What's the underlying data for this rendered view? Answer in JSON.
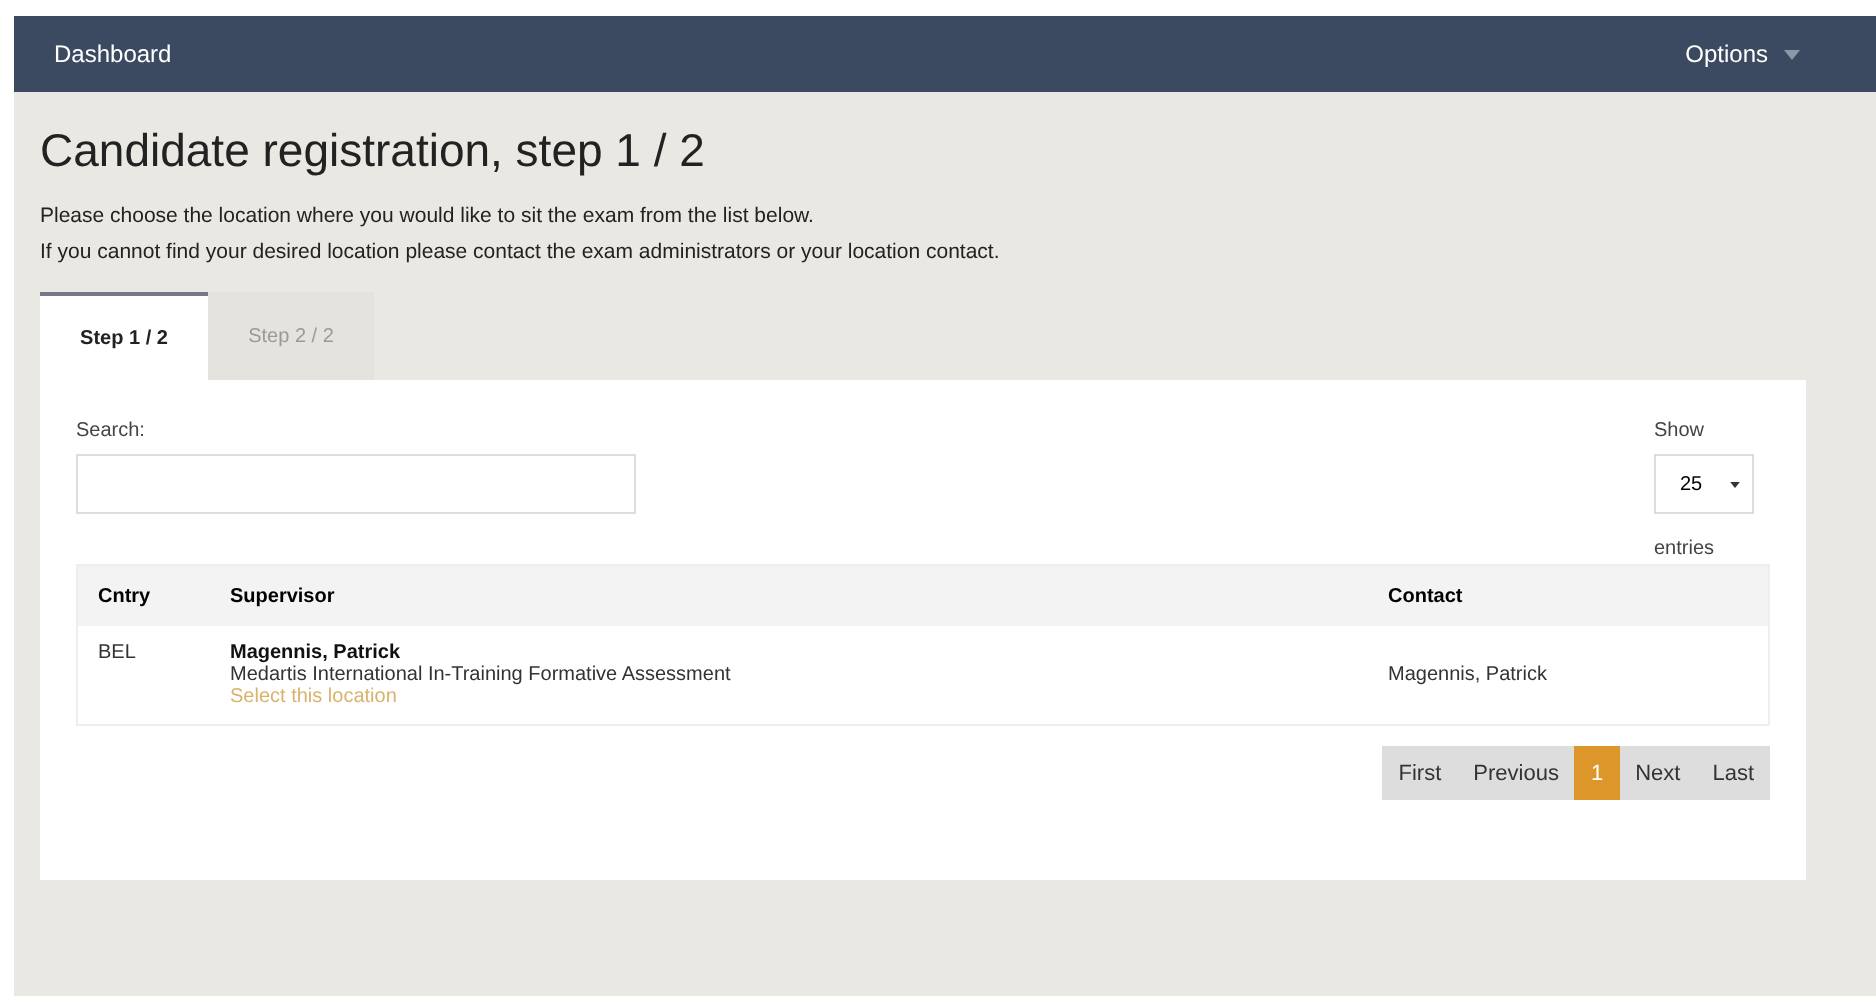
{
  "navbar": {
    "brand": "Dashboard",
    "menu": "Options"
  },
  "title": "Candidate registration, step 1 / 2",
  "intro": [
    "Please choose the location where you would like to sit the exam from the list below.",
    "If you cannot find your desired location please contact the exam administrators or your location contact."
  ],
  "tabs": [
    {
      "label": "Step 1 / 2",
      "selected": true
    },
    {
      "label": "Step 2 / 2",
      "selected": false
    }
  ],
  "search": {
    "label": "Search:"
  },
  "length": {
    "before": "Show",
    "value": "25",
    "after": "entries"
  },
  "table": {
    "columns": [
      "Cntry",
      "Supervisor",
      "Contact"
    ],
    "rows": [
      {
        "country": "BEL",
        "supervisor": "Magennis, Patrick",
        "description": "Medartis International In-Training Formative Assessment",
        "action": "Select this location",
        "contact": "Magennis, Patrick"
      }
    ]
  },
  "pagination": [
    {
      "label": "First",
      "selected": false
    },
    {
      "label": "Previous",
      "selected": false
    },
    {
      "label": "1",
      "selected": true
    },
    {
      "label": "Next",
      "selected": false
    },
    {
      "label": "Last",
      "selected": false
    }
  ]
}
